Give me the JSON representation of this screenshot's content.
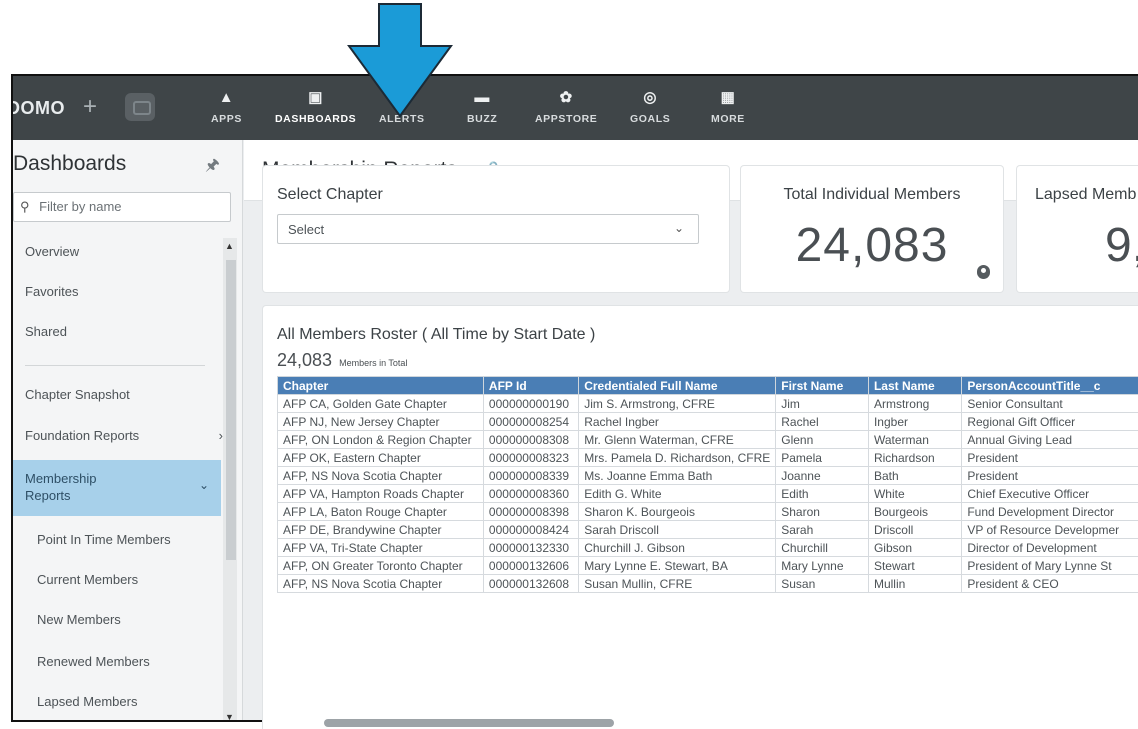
{
  "nav": {
    "logo": "DOMO",
    "plus": "+",
    "items": [
      {
        "label": "APPS",
        "icon": "rocket-icon",
        "glyph": "▲"
      },
      {
        "label": "DASHBOARDS",
        "icon": "dashboard-icon",
        "glyph": "▣"
      },
      {
        "label": "ALERTS",
        "icon": "bell-icon",
        "glyph": "▲"
      },
      {
        "label": "BUZZ",
        "icon": "chat-icon",
        "glyph": "▬"
      },
      {
        "label": "APPSTORE",
        "icon": "appstore-icon",
        "glyph": "✿"
      },
      {
        "label": "GOALS",
        "icon": "target-icon",
        "glyph": "◎"
      },
      {
        "label": "MORE",
        "icon": "grid-icon",
        "glyph": "▦"
      }
    ]
  },
  "sidebar": {
    "title": "Dashboards",
    "filter_placeholder": "Filter by name",
    "items": [
      "Overview",
      "Favorites",
      "Shared",
      "Chapter Snapshot",
      "Foundation Reports"
    ],
    "active": "Membership Reports",
    "subitems": [
      "Point In Time Members",
      "Current Members",
      "New Members",
      "Renewed Members",
      "Lapsed Members"
    ]
  },
  "page": {
    "title": "Membership Reports"
  },
  "cards": {
    "chapter": {
      "title": "Select Chapter",
      "select_value": "Select"
    },
    "total": {
      "title": "Total Individual Members",
      "value": "24,083"
    },
    "lapsed": {
      "title": "Lapsed Memb",
      "value": "9,("
    }
  },
  "roster": {
    "title": "All Members Roster ( All Time by Start Date )",
    "count": "24,083",
    "count_suffix": "Members in Total",
    "columns": [
      "Chapter",
      "AFP Id",
      "Credentialed Full Name",
      "First Name",
      "Last Name",
      "PersonAccountTitle__c"
    ],
    "rows": [
      [
        "AFP CA, Golden Gate Chapter",
        "000000000190",
        "Jim S. Armstrong, CFRE",
        "Jim",
        "Armstrong",
        "Senior Consultant"
      ],
      [
        "AFP NJ, New Jersey Chapter",
        "000000008254",
        "Rachel  Ingber",
        "Rachel",
        "Ingber",
        "Regional Gift Officer"
      ],
      [
        "AFP, ON London & Region Chapter",
        "000000008308",
        "Mr. Glenn  Waterman, CFRE",
        "Glenn",
        "Waterman",
        "Annual Giving Lead"
      ],
      [
        "AFP OK, Eastern Chapter",
        "000000008323",
        "Mrs. Pamela D. Richardson, CFRE",
        "Pamela",
        "Richardson",
        "President"
      ],
      [
        "AFP, NS Nova Scotia Chapter",
        "000000008339",
        "Ms. Joanne Emma Bath",
        "Joanne",
        "Bath",
        "President"
      ],
      [
        "AFP VA, Hampton Roads Chapter",
        "000000008360",
        "Edith G. White",
        "Edith",
        "White",
        "Chief Executive Officer"
      ],
      [
        "AFP LA, Baton Rouge Chapter",
        "000000008398",
        "Sharon K. Bourgeois",
        "Sharon",
        "Bourgeois",
        "Fund Development Director"
      ],
      [
        "AFP DE, Brandywine Chapter",
        "000000008424",
        "Sarah  Driscoll",
        "Sarah",
        "Driscoll",
        "VP of Resource Developmer"
      ],
      [
        "AFP VA, Tri-State Chapter",
        "000000132330",
        "Churchill J. Gibson",
        "Churchill",
        "Gibson",
        "Director of Development"
      ],
      [
        "AFP, ON Greater Toronto Chapter",
        "000000132606",
        "Mary Lynne E. Stewart, BA",
        "Mary Lynne",
        "Stewart",
        "President of Mary Lynne St"
      ],
      [
        "AFP, NS Nova Scotia Chapter",
        "000000132608",
        "Susan  Mullin, CFRE",
        "Susan",
        "Mullin",
        "President & CEO"
      ]
    ]
  }
}
